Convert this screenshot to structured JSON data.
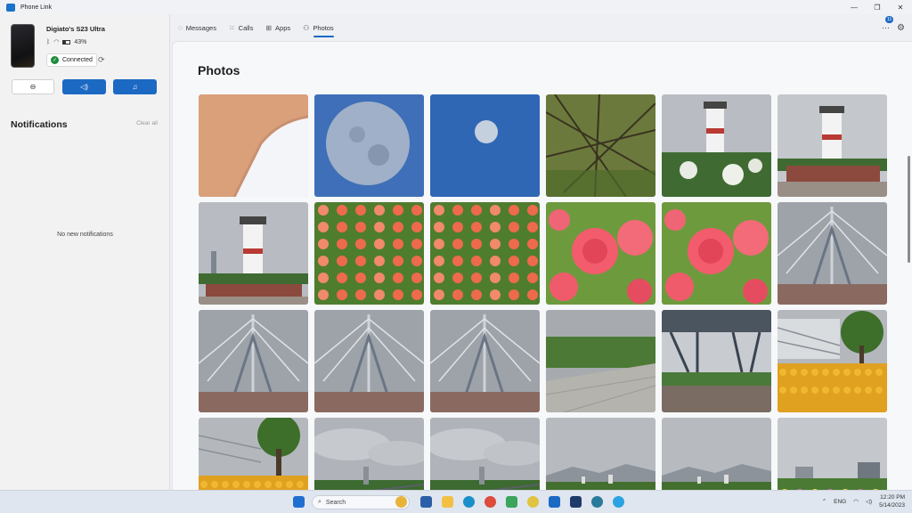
{
  "window": {
    "title": "Phone Link",
    "controls": [
      "—",
      "❐",
      "✕"
    ]
  },
  "device": {
    "name": "Digiato's S23 Ultra",
    "battery": "43%",
    "battery_level": 0.43,
    "connection_status": "Connected"
  },
  "quick_actions": [
    {
      "name": "do-not-disturb-button",
      "icon": "⊖"
    },
    {
      "name": "volume-button",
      "icon": "🔊"
    },
    {
      "name": "media-button",
      "icon": "♫"
    }
  ],
  "notifications": {
    "title": "Notifications",
    "clear_label": "Clear all",
    "empty_text": "No new notifications"
  },
  "nav": {
    "tabs": [
      {
        "label": "Messages",
        "icon": "message-icon",
        "glyph": "💬",
        "active": false
      },
      {
        "label": "Calls",
        "icon": "calls-icon",
        "glyph": "⋮⋮",
        "active": false
      },
      {
        "label": "Apps",
        "icon": "apps-icon",
        "glyph": "⊞",
        "active": false
      },
      {
        "label": "Photos",
        "icon": "photos-icon",
        "glyph": "⚇",
        "active": true
      }
    ],
    "badge_count": "11"
  },
  "photos": {
    "title": "Photos",
    "items": [
      "closeup-skin",
      "moon-large",
      "moon-small",
      "tree-branches",
      "lighthouse-flowers",
      "lighthouse",
      "lighthouse-wide",
      "pink-flowers",
      "pink-flowers",
      "rose-closeup",
      "rose-closeup",
      "cable-bridge",
      "cable-bridge",
      "cable-bridge",
      "cable-bridge",
      "park-path",
      "pavilion",
      "flower-garden",
      "flower-garden-tree",
      "cloudy-skyline",
      "cloudy-skyline",
      "mountain-view",
      "mountain-view",
      "garden-buildings"
    ]
  },
  "taskbar": {
    "search_placeholder": "Search",
    "language": "ENG",
    "time": "12:20 PM",
    "date": "5/14/2023"
  },
  "colors": {
    "accent": "#1c69c4",
    "connected": "#1f8c3a"
  }
}
